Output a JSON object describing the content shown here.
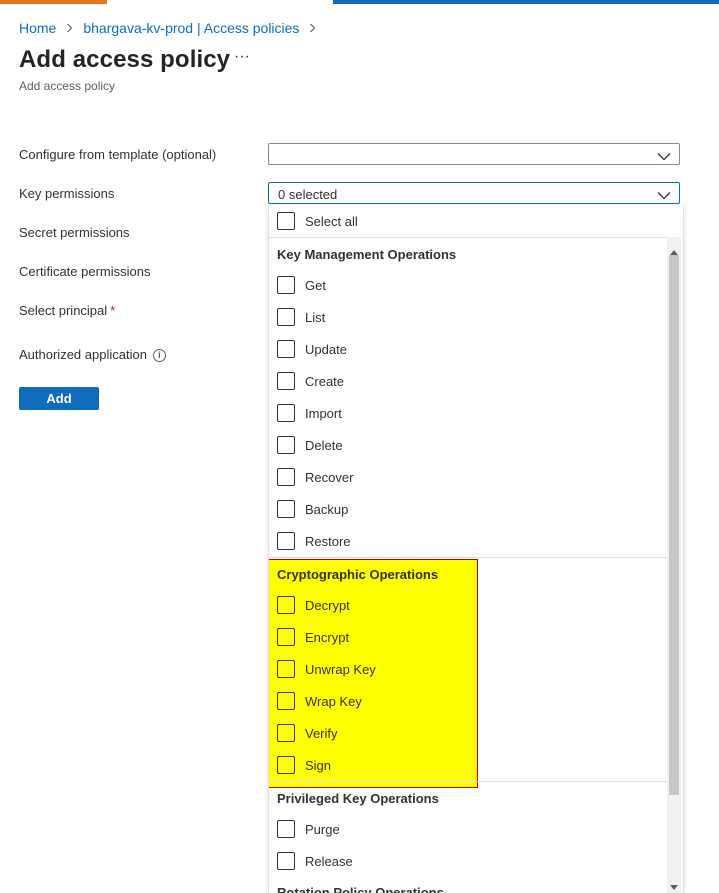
{
  "breadcrumb": {
    "items": [
      "Home",
      "bhargava-kv-prod | Access policies"
    ]
  },
  "page": {
    "title": "Add access policy",
    "more_label": "···",
    "subtitle": "Add access policy"
  },
  "form": {
    "template_label": "Configure from template (optional)",
    "template_value": "",
    "key_permissions_label": "Key permissions",
    "key_permissions_value": "0 selected",
    "secret_permissions_label": "Secret permissions",
    "certificate_permissions_label": "Certificate permissions",
    "select_principal_label": "Select principal",
    "required_mark": "*",
    "authorized_application_label": "Authorized application",
    "info_glyph": "i",
    "add_button": "Add"
  },
  "dropdown_panel": {
    "select_all": "Select all",
    "groups": [
      {
        "header": "Key Management Operations",
        "items": [
          "Get",
          "List",
          "Update",
          "Create",
          "Import",
          "Delete",
          "Recover",
          "Backup",
          "Restore"
        ]
      },
      {
        "header": "Cryptographic Operations",
        "items": [
          "Decrypt",
          "Encrypt",
          "Unwrap Key",
          "Wrap Key",
          "Verify",
          "Sign"
        ]
      },
      {
        "header": "Privileged Key Operations",
        "items": [
          "Purge",
          "Release"
        ]
      },
      {
        "header": "Rotation Policy Operations",
        "items": []
      }
    ]
  },
  "colors": {
    "accent": "#0f6cbd",
    "highlight": "#ffff00",
    "highlight_border": "#c00000"
  }
}
